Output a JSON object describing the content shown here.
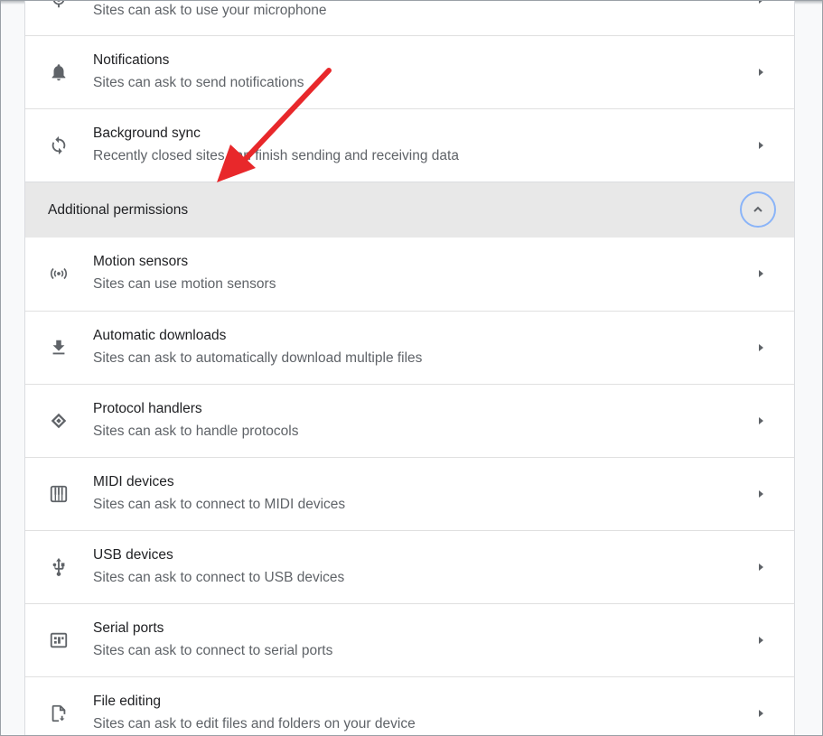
{
  "rows_top": [
    {
      "title": "",
      "desc": "Sites can ask to use your microphone",
      "icon": "microphone-icon"
    },
    {
      "title": "Notifications",
      "desc": "Sites can ask to send notifications",
      "icon": "bell-icon"
    },
    {
      "title": "Background sync",
      "desc": "Recently closed sites can finish sending and receiving data",
      "icon": "sync-icon"
    }
  ],
  "section": {
    "label": "Additional permissions",
    "toggle_icon": "chevron-up-icon",
    "expanded": true
  },
  "rows_additional": [
    {
      "title": "Motion sensors",
      "desc": "Sites can use motion sensors",
      "icon": "motion-sensor-icon"
    },
    {
      "title": "Automatic downloads",
      "desc": "Sites can ask to automatically download multiple files",
      "icon": "download-icon"
    },
    {
      "title": "Protocol handlers",
      "desc": "Sites can ask to handle protocols",
      "icon": "protocol-handler-icon"
    },
    {
      "title": "MIDI devices",
      "desc": "Sites can ask to connect to MIDI devices",
      "icon": "piano-icon"
    },
    {
      "title": "USB devices",
      "desc": "Sites can ask to connect to USB devices",
      "icon": "usb-icon"
    },
    {
      "title": "Serial ports",
      "desc": "Sites can ask to connect to serial ports",
      "icon": "serial-port-icon"
    },
    {
      "title": "File editing",
      "desc": "Sites can ask to edit files and folders on your device",
      "icon": "file-edit-icon"
    }
  ],
  "colors": {
    "arrow": "#e8282b",
    "section_bg": "#e8e8e8",
    "toggle_ring": "#8ab4f8"
  }
}
